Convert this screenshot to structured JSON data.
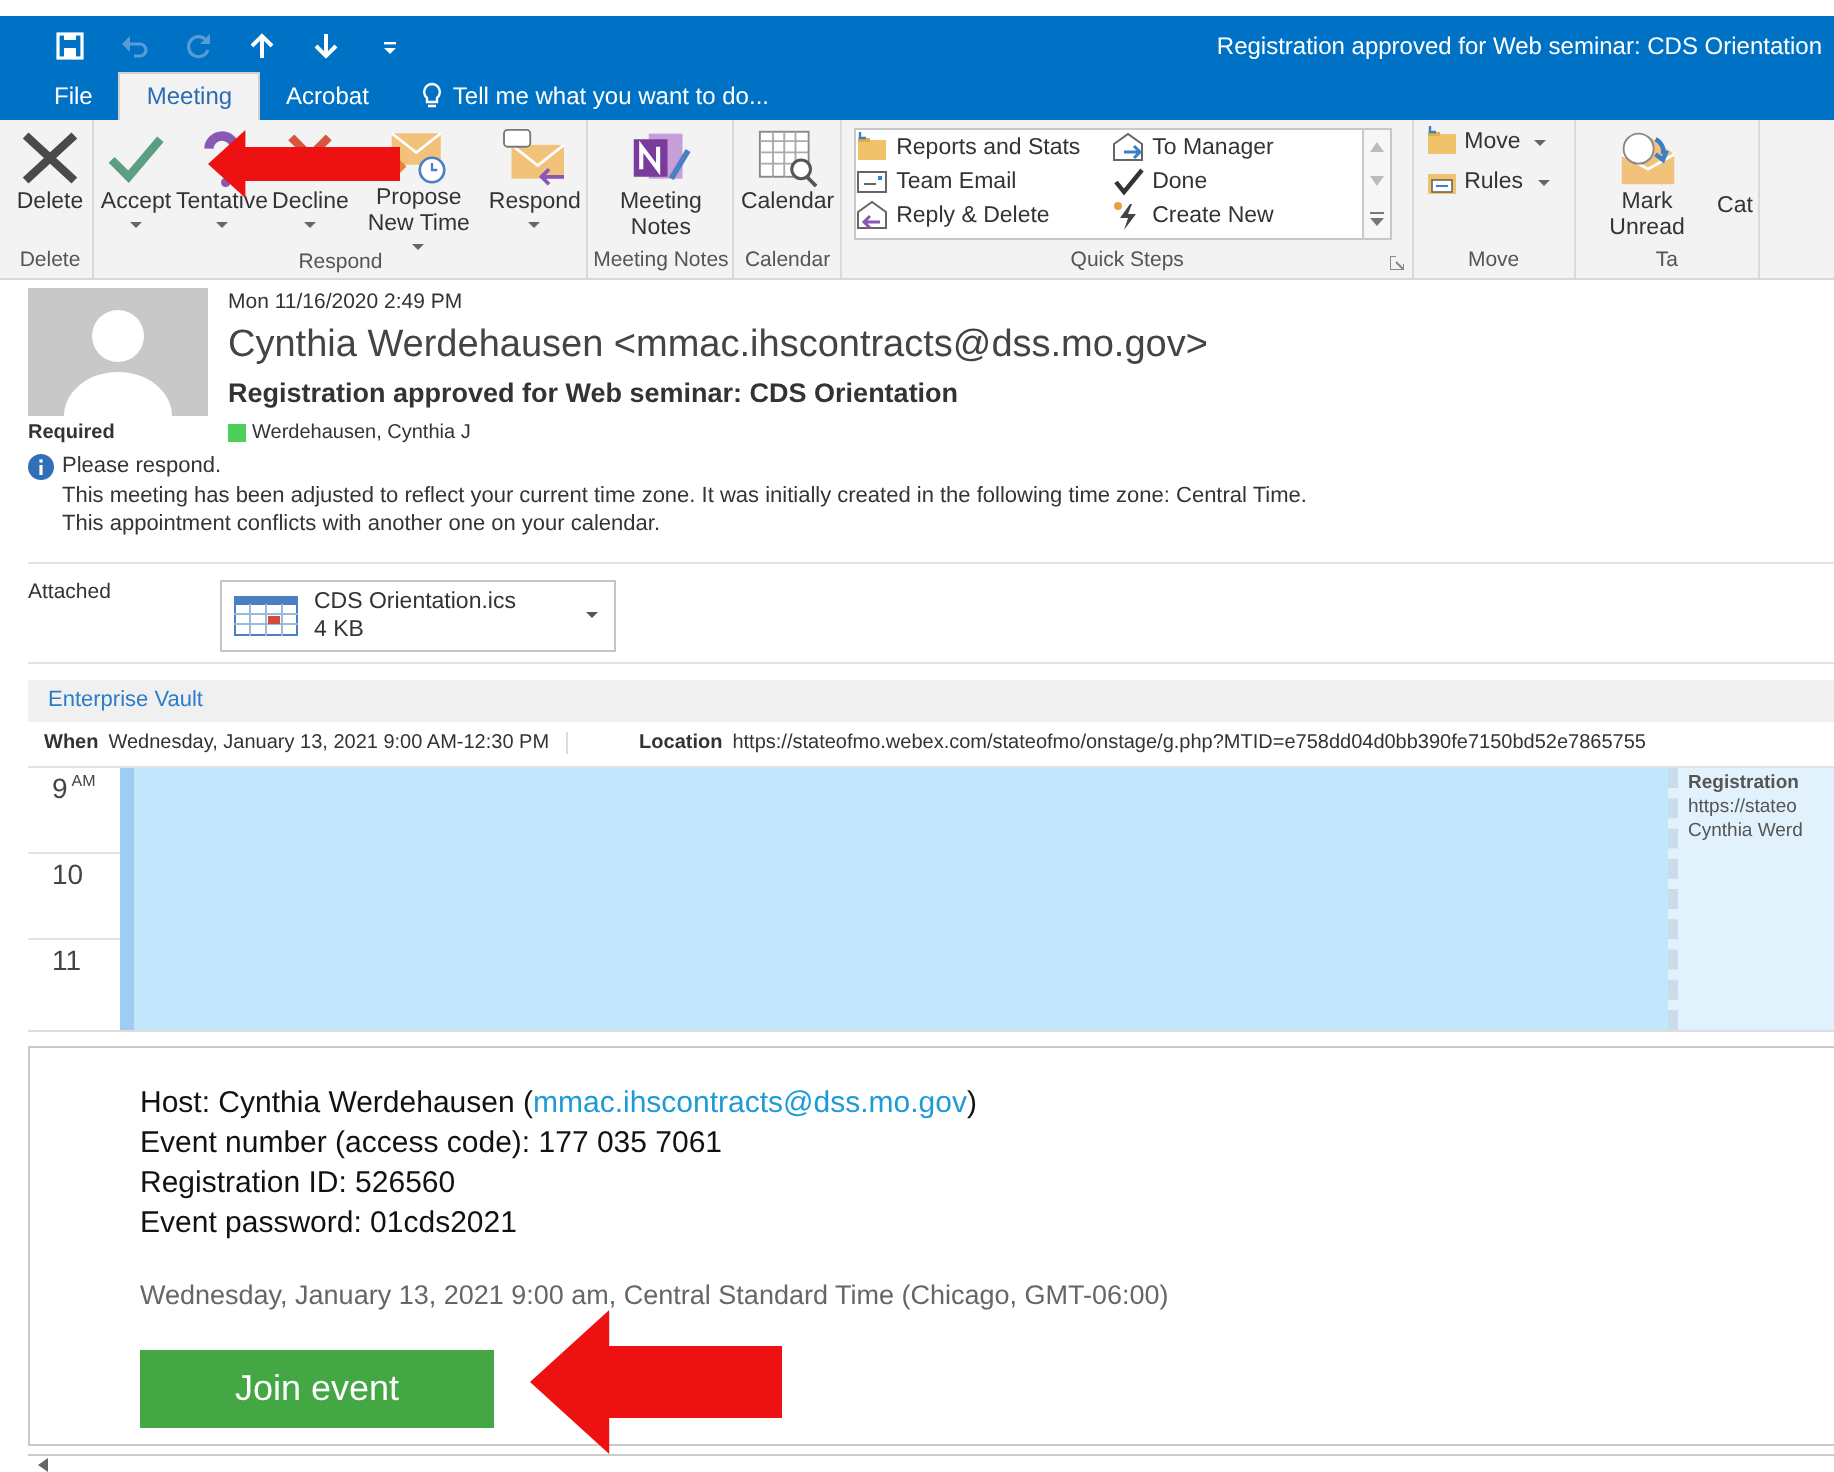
{
  "window": {
    "title": "Registration approved for Web seminar: CDS Orientation"
  },
  "quick_access": [
    {
      "kind": "save",
      "disabled": false
    },
    {
      "kind": "undo",
      "disabled": true
    },
    {
      "kind": "redo",
      "disabled": true
    },
    {
      "kind": "up",
      "disabled": false
    },
    {
      "kind": "down",
      "disabled": false
    },
    {
      "kind": "customize",
      "disabled": false
    }
  ],
  "tabs": [
    {
      "label": "File",
      "selected": false
    },
    {
      "label": "Meeting",
      "selected": true
    },
    {
      "label": "Acrobat",
      "selected": false
    }
  ],
  "tell_me": {
    "placeholder": "Tell me what you want to do..."
  },
  "ribbon": {
    "groups": [
      {
        "label": "Delete",
        "kind": "large",
        "buttons": [
          {
            "label": "Delete",
            "kind": "delete",
            "dropdown": false
          }
        ]
      },
      {
        "label": "Respond",
        "kind": "large",
        "buttons": [
          {
            "label": "Accept",
            "kind": "accept",
            "dropdown": true
          },
          {
            "label": "Tentative",
            "kind": "tentative",
            "dropdown": true
          },
          {
            "label": "Decline",
            "kind": "decline",
            "dropdown": true
          },
          {
            "label": "Propose New Time",
            "kind": "propose",
            "dropdown": true
          },
          {
            "label": "Respond",
            "kind": "respond",
            "dropdown": true
          }
        ]
      },
      {
        "label": "Meeting Notes",
        "kind": "large",
        "buttons": [
          {
            "label": "Meeting Notes",
            "kind": "notes",
            "dropdown": false
          }
        ]
      },
      {
        "label": "Calendar",
        "kind": "large",
        "buttons": [
          {
            "label": "Calendar",
            "kind": "calendar",
            "dropdown": false
          }
        ]
      },
      {
        "label": "Quick Steps",
        "kind": "gallery",
        "items": [
          {
            "label": "Reports and Stats",
            "kind": "folder"
          },
          {
            "label": "To Manager",
            "kind": "forward"
          },
          {
            "label": "Team Email",
            "kind": "card"
          },
          {
            "label": "Done",
            "kind": "check"
          },
          {
            "label": "Reply & Delete",
            "kind": "reply"
          },
          {
            "label": "Create New",
            "kind": "bolt"
          }
        ]
      },
      {
        "label": "Move",
        "kind": "small",
        "buttons": [
          {
            "label": "Move",
            "kind": "folder",
            "dropdown": true
          },
          {
            "label": "Rules",
            "kind": "rules",
            "dropdown": true
          }
        ]
      },
      {
        "label": "Ta",
        "kind": "large",
        "buttons": [
          {
            "label": "Mark Unread",
            "kind": "unread",
            "dropdown": false
          },
          {
            "label": "Cat",
            "kind": "none",
            "dropdown": false
          }
        ]
      }
    ]
  },
  "message": {
    "sent": "Mon 11/16/2020 2:49 PM",
    "from": "Cynthia Werdehausen <mmac.ihscontracts@dss.mo.gov>",
    "subject": "Registration approved for Web seminar: CDS Orientation",
    "required_label": "Required",
    "attendees": [
      {
        "name": "Werdehausen, Cynthia J",
        "color": "#4cd05a"
      }
    ],
    "info": [
      "Please respond.",
      "This meeting has been adjusted to reflect your current time zone. It was initially created in the following time zone: Central Time.",
      "This appointment conflicts with another one on your calendar."
    ],
    "attached_label": "Attached",
    "attachments": [
      {
        "name": "CDS Orientation.ics",
        "size": "4 KB"
      }
    ]
  },
  "addin_bar": {
    "label": "Enterprise Vault"
  },
  "details": [
    {
      "label": "When",
      "value": "Wednesday, January 13, 2021 9:00 AM-12:30 PM"
    },
    {
      "label": "Location",
      "value": "https://stateofmo.webex.com/stateofmo/onstage/g.php?MTID=e758dd04d0bb390fe7150bd52e7865755"
    }
  ],
  "calendar": {
    "hours": [
      {
        "hour": "9",
        "suffix": "AM"
      },
      {
        "hour": "10"
      },
      {
        "hour": "11"
      }
    ],
    "conflict": {
      "title": "Registration",
      "lines": [
        "https://stateo",
        "Cynthia Werd"
      ]
    }
  },
  "body": {
    "host": {
      "before": "Host: Cynthia Werdehausen (",
      "link": "mmac.ihscontracts@dss.mo.gov",
      "after": ")"
    },
    "lines": [
      "Event number (access code): 177 035 7061",
      "Registration ID: 526560",
      "Event password: 01cds2021"
    ],
    "time": "Wednesday, January 13, 2021 9:00 am, Central Standard Time (Chicago, GMT-06:00)",
    "join_button": "Join event"
  }
}
